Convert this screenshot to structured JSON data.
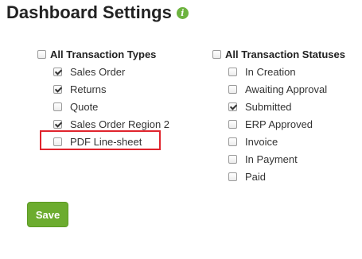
{
  "page_title": "Dashboard Settings",
  "info_icon": "info-icon",
  "transaction_types": {
    "header": "All Transaction Types",
    "header_checked": false,
    "items": [
      {
        "label": "Sales Order",
        "checked": true
      },
      {
        "label": "Returns",
        "checked": true
      },
      {
        "label": "Quote",
        "checked": false
      },
      {
        "label": "Sales Order Region 2",
        "checked": true
      },
      {
        "label": "PDF Line-sheet",
        "checked": false,
        "highlighted": true
      }
    ]
  },
  "transaction_statuses": {
    "header": "All Transaction Statuses",
    "header_checked": false,
    "items": [
      {
        "label": "In Creation",
        "checked": false
      },
      {
        "label": "Awaiting Approval",
        "checked": false
      },
      {
        "label": "Submitted",
        "checked": true
      },
      {
        "label": "ERP Approved",
        "checked": false
      },
      {
        "label": "Invoice",
        "checked": false
      },
      {
        "label": "In Payment",
        "checked": false
      },
      {
        "label": "Paid",
        "checked": false
      }
    ]
  },
  "save_label": "Save",
  "colors": {
    "accent_green": "#6cac2f",
    "highlight_red": "#e0242d"
  }
}
